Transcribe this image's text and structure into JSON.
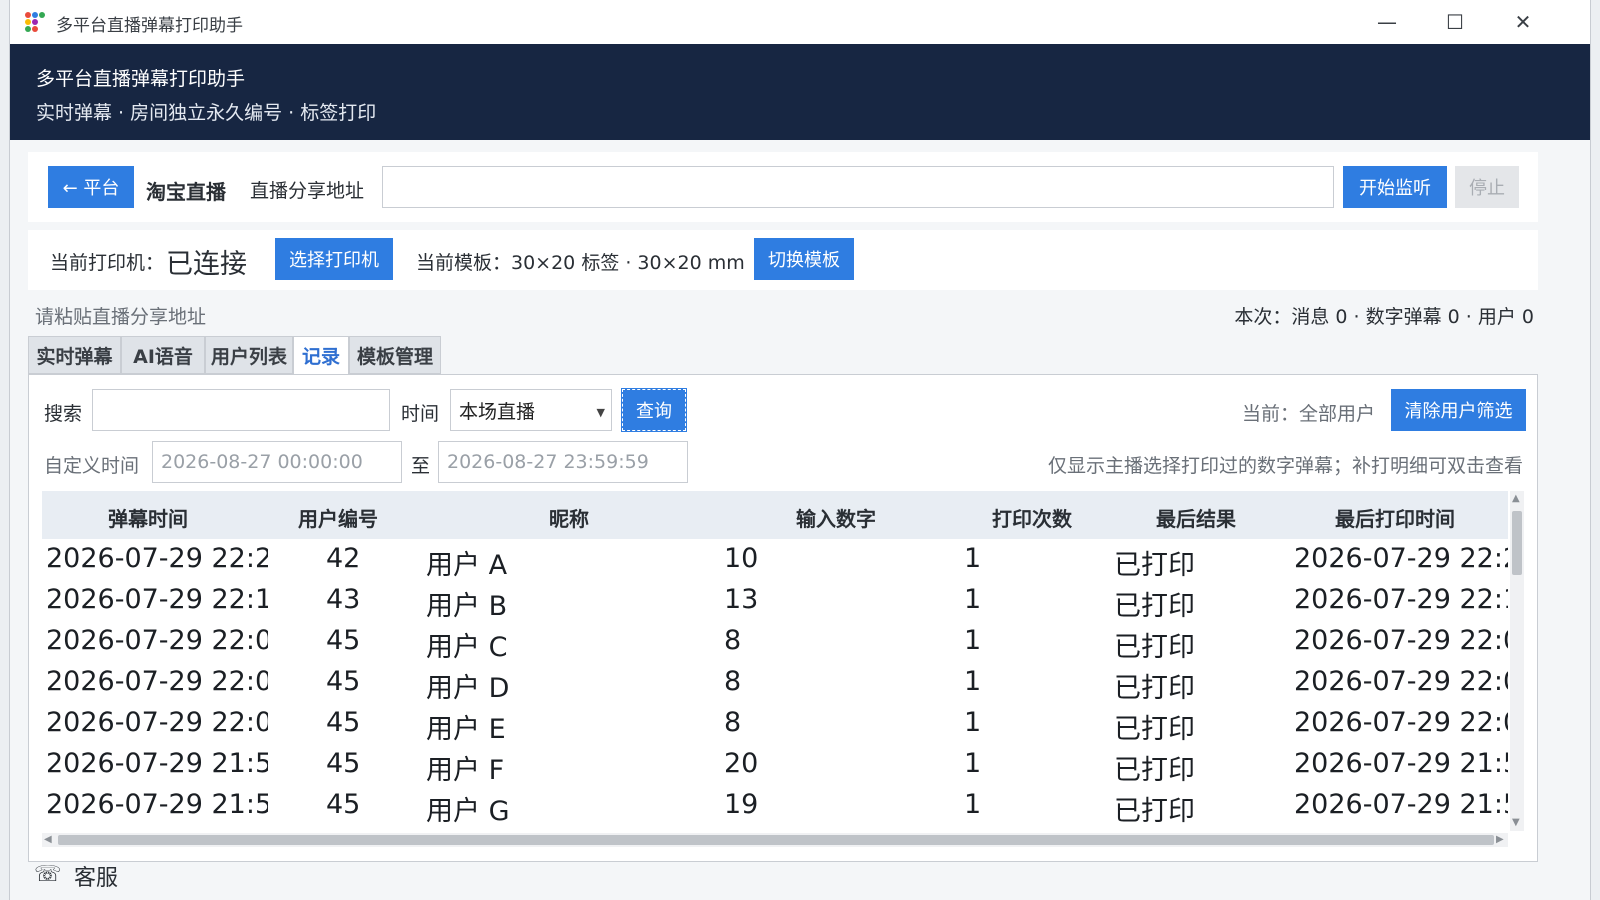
{
  "window": {
    "title": "多平台直播弹幕打印助手",
    "minimize": "—",
    "maximize": "☐",
    "close": "✕"
  },
  "header": {
    "title": "多平台直播弹幕打印助手",
    "subtitle": "实时弹幕 · 房间独立永久编号 · 标签打印"
  },
  "top_bar": {
    "back_button": "← 平台",
    "platform": "淘宝直播",
    "url_label": "直播分享地址",
    "url_value": "",
    "start_button": "开始监听",
    "stop_button": "停止"
  },
  "printer_bar": {
    "printer_label": "当前打印机：",
    "printer_status": "已连接",
    "select_printer_button": "选择打印机",
    "template_label": "当前模板：30×20 标签 · 30×20 mm",
    "switch_template_button": "切换模板"
  },
  "status": {
    "hint": "请粘贴直播分享地址",
    "stats": "本次：消息 0 · 数字弹幕 0 · 用户 0"
  },
  "tabs": [
    {
      "label": "实时弹幕"
    },
    {
      "label": "AI语音"
    },
    {
      "label": "用户列表"
    },
    {
      "label": "记录"
    },
    {
      "label": "模板管理"
    }
  ],
  "records": {
    "search_label": "搜索",
    "search_value": "",
    "time_label": "时间",
    "time_select": "本场直播",
    "query_button": "查询",
    "current_filter": "当前：全部用户",
    "clear_filter_button": "清除用户筛选",
    "custom_time_label": "自定义时间",
    "start_time": "2026-08-27 00:00:00",
    "to_label": "至",
    "end_time": "2026-08-27 23:59:59",
    "note": "仅显示主播选择打印过的数字弹幕；补打明细可双击查看"
  },
  "table": {
    "columns": [
      "弹幕时间",
      "用户编号",
      "昵称",
      "输入数字",
      "打印次数",
      "最后结果",
      "最后打印时间"
    ],
    "rows": [
      [
        "2026-07-29 22:2",
        "42",
        "用户 A",
        "10",
        "1",
        "已打印",
        "2026-07-29 22:2"
      ],
      [
        "2026-07-29 22:1",
        "43",
        "用户 B",
        "13",
        "1",
        "已打印",
        "2026-07-29 22:1"
      ],
      [
        "2026-07-29 22:0",
        "45",
        "用户 C",
        "8",
        "1",
        "已打印",
        "2026-07-29 22:0"
      ],
      [
        "2026-07-29 22:0",
        "45",
        "用户 D",
        "8",
        "1",
        "已打印",
        "2026-07-29 22:0"
      ],
      [
        "2026-07-29 22:0",
        "45",
        "用户 E",
        "8",
        "1",
        "已打印",
        "2026-07-29 22:0"
      ],
      [
        "2026-07-29 21:5",
        "45",
        "用户 F",
        "20",
        "1",
        "已打印",
        "2026-07-29 21:5"
      ],
      [
        "2026-07-29 21:5",
        "45",
        "用户 G",
        "19",
        "1",
        "已打印",
        "2026-07-29 21:5"
      ]
    ]
  },
  "bottom_peek": "客服",
  "colors": {
    "header_bg": "#172642",
    "accent": "#2f7de1",
    "active_tab": "#2f6fd1"
  }
}
